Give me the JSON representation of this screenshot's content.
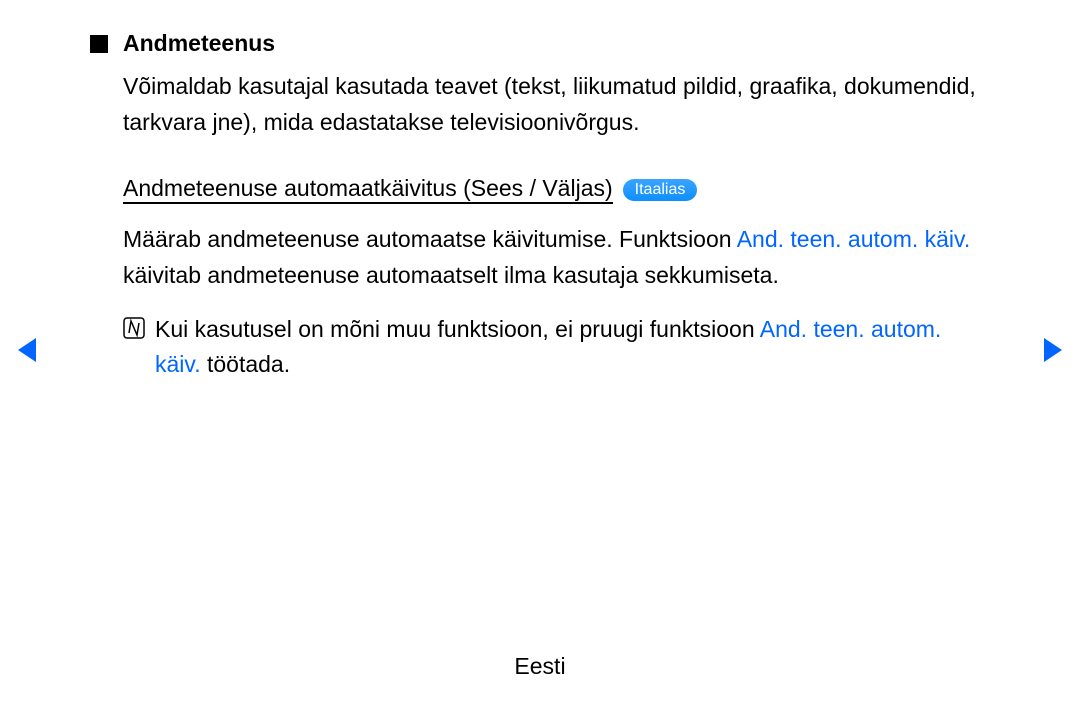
{
  "section": {
    "title": "Andmeteenus",
    "intro": "Võimaldab kasutajal kasutada teavet (tekst, liikumatud pildid, graafika, dokumendid, tarkvara jne), mida edastatakse televisioonivõrgus."
  },
  "subsection": {
    "title": "Andmeteenuse automaatkäivitus (Sees / Väljas)",
    "badge": "Itaalias",
    "desc_part1": "Määrab andmeteenuse automaatse käivitumise. Funktsioon ",
    "desc_highlight1": "And. teen. autom. käiv.",
    "desc_part2": " käivitab andmeteenuse automaatselt ilma kasutaja sekkumiseta."
  },
  "note": {
    "part1": "Kui kasutusel on mõni muu funktsioon, ei pruugi funktsioon ",
    "highlight": "And. teen. autom. käiv.",
    "part2": " töötada."
  },
  "footer": "Eesti"
}
